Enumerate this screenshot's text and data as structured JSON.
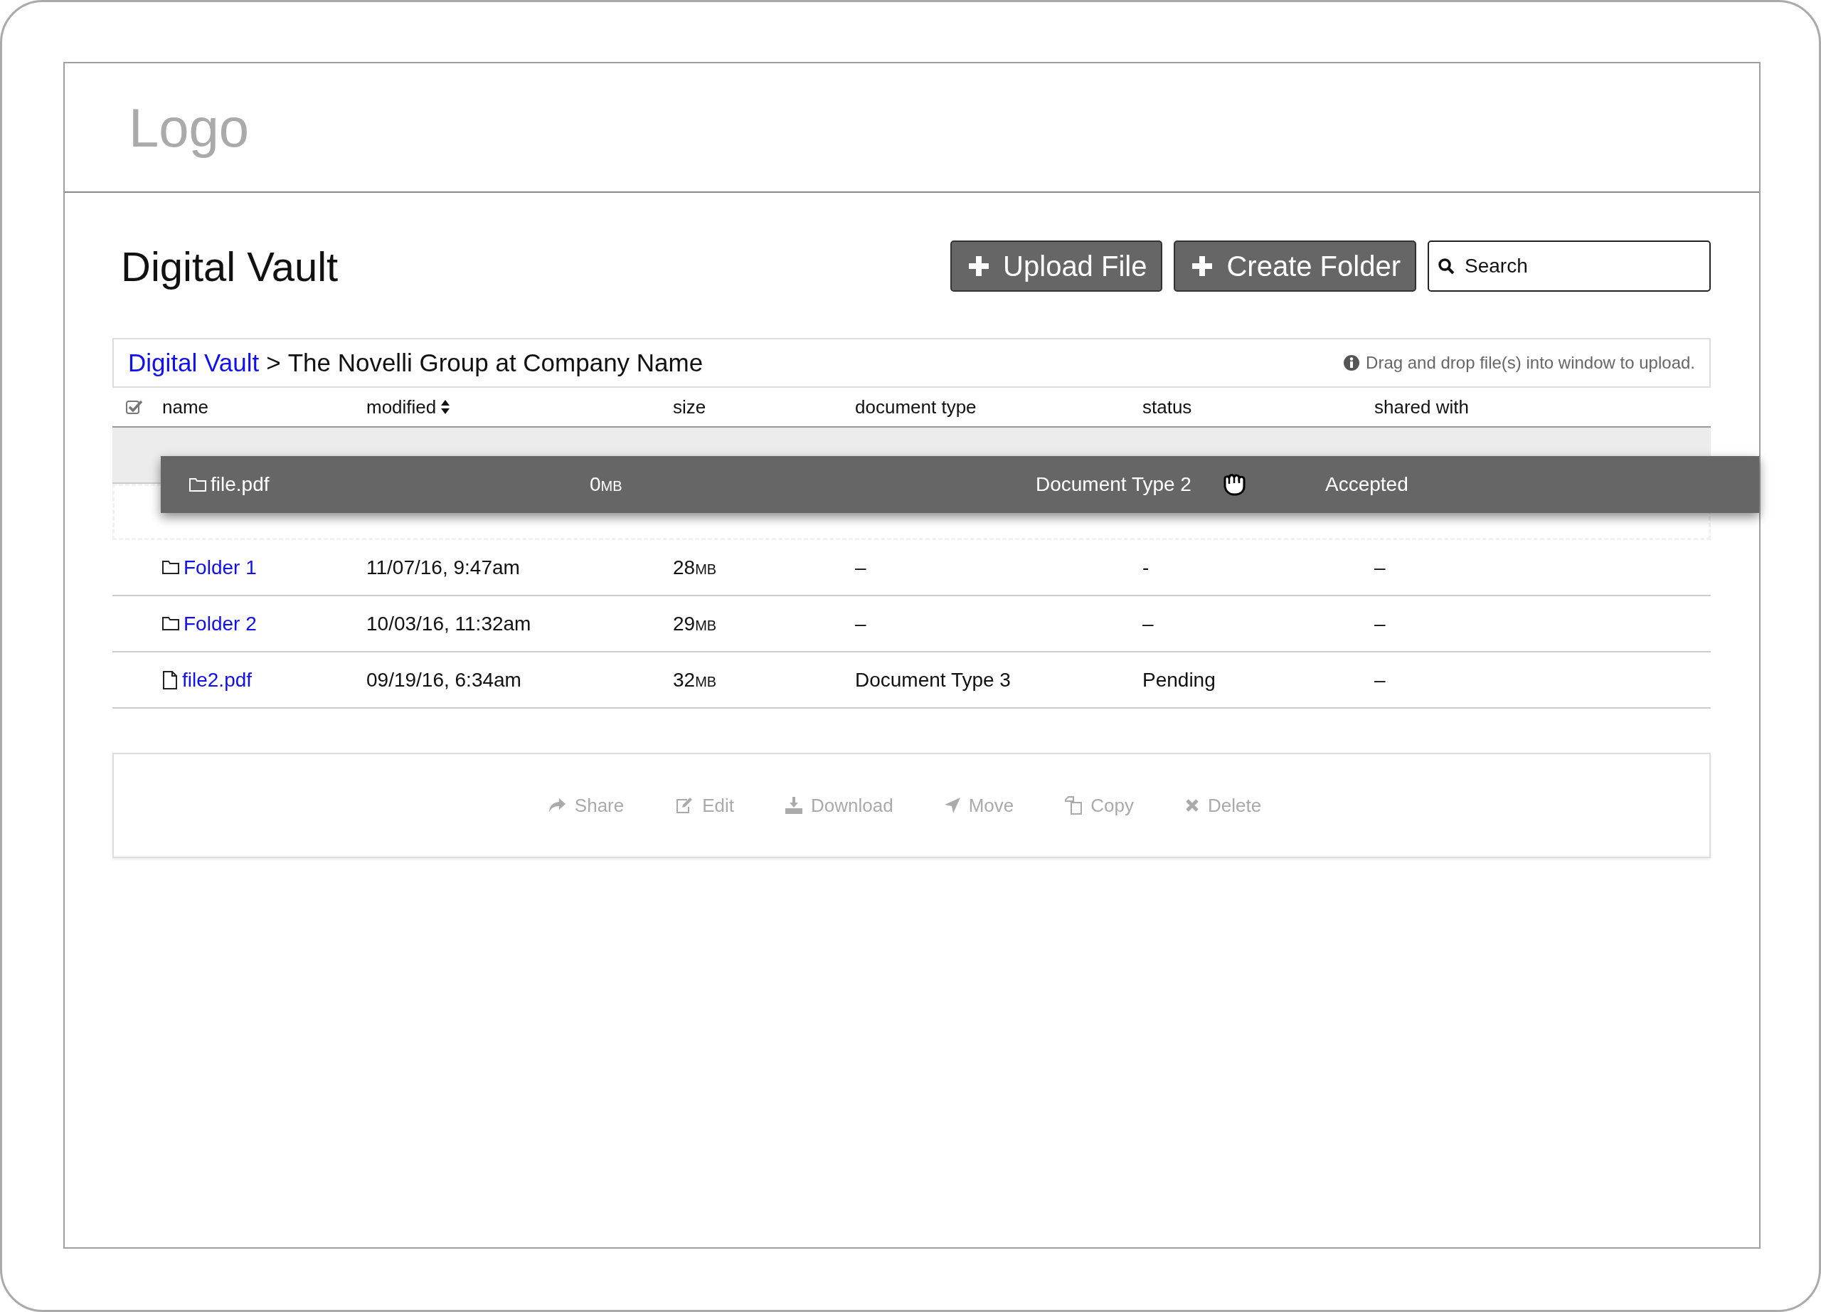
{
  "logo": "Logo",
  "title": "Digital Vault",
  "buttons": [
    {
      "label": "Upload File"
    },
    {
      "label": "Create Folder"
    }
  ],
  "search": {
    "placeholder": "Search"
  },
  "breadcrumb": {
    "link": "Digital Vault",
    "separator": ">",
    "current": "The Novelli Group at Company Name"
  },
  "hint": "Drag and drop file(s) into window to upload.",
  "table": {
    "select_all_checked": true,
    "columns": [
      {
        "label": "name",
        "sortable": false
      },
      {
        "label": "modified",
        "sortable": true
      },
      {
        "label": "size",
        "sortable": false
      },
      {
        "label": "document type",
        "sortable": false
      },
      {
        "label": "status",
        "sortable": false
      },
      {
        "label": "shared with",
        "sortable": false
      }
    ],
    "rows": [
      {
        "highlighted": true,
        "placeholder": false
      },
      {
        "highlighted": false,
        "placeholder": true
      },
      {
        "kind": "folder",
        "name": "Folder 1",
        "modified": "11/07/16, 9:47am",
        "size": "28",
        "unit": "MB",
        "document_type": "–",
        "status": "-",
        "shared_with": "–",
        "highlighted": false,
        "placeholder": false
      },
      {
        "kind": "folder",
        "name": "Folder 2",
        "modified": "10/03/16, 11:32am",
        "size": "29",
        "unit": "MB",
        "document_type": "–",
        "status": "–",
        "shared_with": "–",
        "highlighted": false,
        "placeholder": false
      },
      {
        "kind": "file",
        "name": "file2.pdf",
        "modified": "09/19/16, 6:34am",
        "size": "32",
        "unit": "MB",
        "document_type": "Document Type 3",
        "status": "Pending",
        "shared_with": "–",
        "highlighted": false,
        "placeholder": false
      }
    ],
    "dragged_row": {
      "kind": "folder",
      "name": "file.pdf",
      "size": "0",
      "unit": "MB",
      "document_type": "Document Type 2",
      "status": "Accepted"
    }
  },
  "actions": [
    {
      "kind": "share",
      "label": "Share",
      "disabled": true
    },
    {
      "kind": "edit",
      "label": "Edit",
      "disabled": true
    },
    {
      "kind": "download",
      "label": "Download",
      "disabled": true
    },
    {
      "kind": "move",
      "label": "Move",
      "disabled": true
    },
    {
      "kind": "copy",
      "label": "Copy",
      "disabled": true
    },
    {
      "kind": "delete",
      "label": "Delete",
      "disabled": true
    }
  ]
}
